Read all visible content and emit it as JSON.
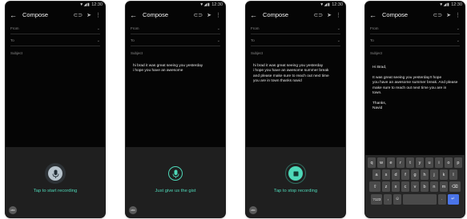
{
  "status": {
    "time": "12:30",
    "icons": "▼◢▮"
  },
  "compose": {
    "title": "Compose",
    "from_label": "From",
    "to_label": "To",
    "subject_label": "Subject"
  },
  "screens": [
    {
      "body": "",
      "hint": "Tap to start recording",
      "mic_state": "idle"
    },
    {
      "body": "hi brad it was great seeing you yesterday\ni hope you have an awesome",
      "hint": "Just give us the gist",
      "mic_state": "listening"
    },
    {
      "body": "hi brad it was great seeing you yesterday\ni hope you have an awesome summer break\nand please make sure to reach out next time\nyou are in town thanks navid",
      "hint": "Tap to stop recording",
      "mic_state": "recording"
    },
    {
      "body": "Hi Brad,\n\nIt was great seeing you yesterday!! hope\nyou have an awesome summer break. And please\nmake sure to reach out next time you are in\ntown.\n\nThanks,\nNavid",
      "hint": "",
      "mic_state": "keyboard"
    }
  ],
  "abc_label": "ABC",
  "keyboard": {
    "row1": [
      "q",
      "w",
      "e",
      "r",
      "t",
      "y",
      "u",
      "i",
      "o",
      "p"
    ],
    "row2": [
      "a",
      "s",
      "d",
      "f",
      "g",
      "h",
      "j",
      "k",
      "l"
    ],
    "row3": [
      "⇧",
      "z",
      "x",
      "c",
      "v",
      "b",
      "n",
      "m",
      "⌫"
    ],
    "row4": [
      "?123",
      ",",
      "☺",
      "",
      ".",
      " ↵"
    ]
  },
  "colors": {
    "accent": "#4ed8b8",
    "mic_idle": "#b7c3cc",
    "mic_active": "#4ed8b8",
    "enter_key": "#4a74e8"
  }
}
